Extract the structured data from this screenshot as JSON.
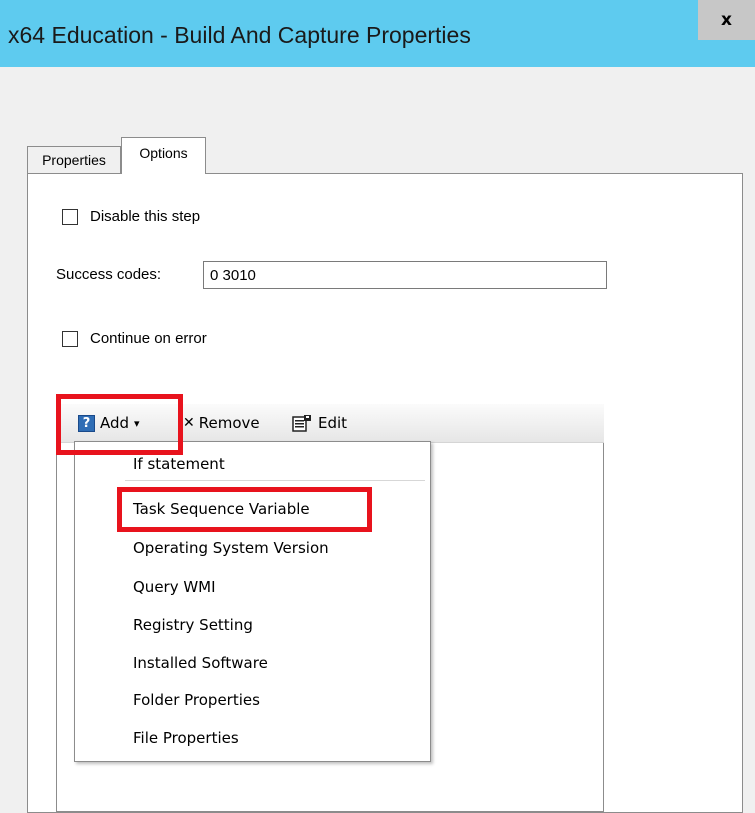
{
  "window": {
    "title": "x64 Education - Build And Capture Properties",
    "close_glyph": "x"
  },
  "tabs": [
    {
      "label": "Properties",
      "active": false
    },
    {
      "label": "Options",
      "active": true
    }
  ],
  "options": {
    "disable_step_label": "Disable this step",
    "disable_step_checked": false,
    "success_codes_label": "Success codes:",
    "success_codes_value": "0 3010",
    "continue_on_error_label": "Continue on error",
    "continue_on_error_checked": false
  },
  "toolbar": {
    "add_icon_glyph": "?",
    "add_label": "Add",
    "add_arrow": "▾",
    "remove_icon_glyph": "✕",
    "remove_label": "Remove",
    "edit_label": "Edit"
  },
  "add_menu": {
    "items": [
      "If statement",
      "Task Sequence Variable",
      "Operating System Version",
      "Query WMI",
      "Registry Setting",
      "Installed Software",
      "Folder Properties",
      "File Properties"
    ]
  },
  "colors": {
    "titlebar": "#5ecbef",
    "highlight": "#e8131d",
    "add_icon": "#2f6db5"
  },
  "icons": {
    "add": "help-query-icon",
    "remove": "remove-x-icon",
    "edit": "edit-properties-icon",
    "close": "close-icon"
  }
}
